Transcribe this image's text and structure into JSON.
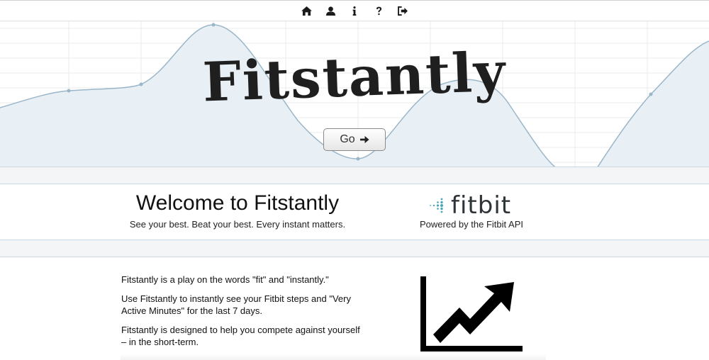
{
  "nav": {
    "items": [
      {
        "icon": "home-icon"
      },
      {
        "icon": "user-icon"
      },
      {
        "icon": "info-icon"
      },
      {
        "icon": "question-icon"
      },
      {
        "icon": "sign-out-icon"
      }
    ]
  },
  "hero": {
    "brand": "Fitstantly",
    "go_label": "Go",
    "line_color": "#9ab6c8",
    "fill_color": "#e9f0f5"
  },
  "welcome": {
    "title": "Welcome to Fitstantly",
    "tagline": "See your best. Beat your best. Every instant matters."
  },
  "fitbit": {
    "logo_text": "fitbit",
    "powered_by": "Powered by the Fitbit API"
  },
  "about": {
    "paragraphs": [
      "Fitstantly is a play on the words \"fit\" and \"instantly.\"",
      "Use Fitstantly to instantly see your Fitbit steps and \"Very Active Minutes\" for the last 7 days.",
      "Fitstantly is designed to help you compete against yourself – in the short-term."
    ]
  },
  "trend_icon": {
    "icon": "trending-up-chart-icon"
  }
}
